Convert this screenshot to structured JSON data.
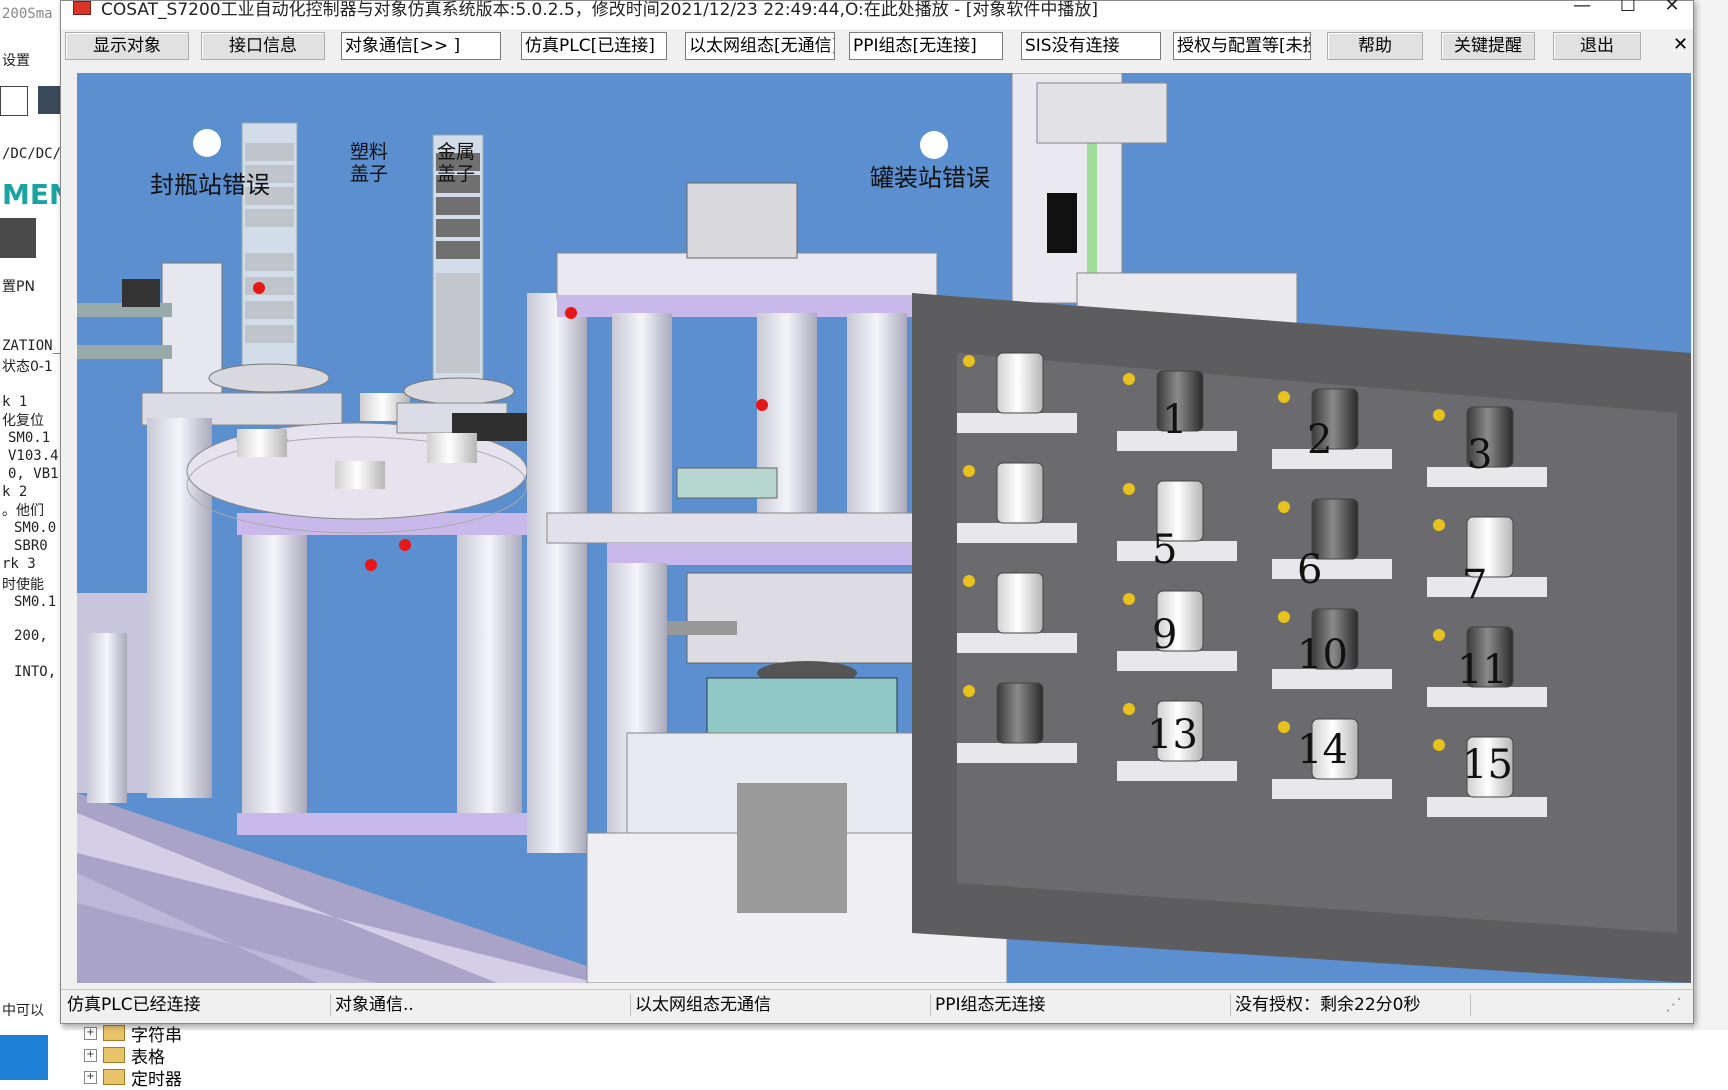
{
  "window": {
    "title": "COSAT_S7200工业自动化控制器与对象仿真系统版本:5.0.2.5，修改时间2021/12/23 22:49:44,O:在此处播放 - [对象软件中播放]",
    "minimize": "—",
    "maximize": "☐",
    "close": "✕"
  },
  "toolbar": {
    "show_objects": "显示对象",
    "interface_info": "接口信息",
    "object_comm": "对象通信[>>  ]",
    "sim_plc": "仿真PLC[已连接]",
    "ethernet": "以太网组态[无通信]",
    "ppi": "PPI组态[无连接]",
    "sis": "SIS没有连接",
    "license": "授权与配置等[未授权]",
    "help": "帮助",
    "key_reminder": "关键提醒",
    "exit": "退出",
    "close_x": "✕"
  },
  "scene": {
    "capping_error": "封瓶站错误",
    "filling_error": "罐装站错误",
    "plastic_cap": [
      "塑料",
      "盖子"
    ],
    "metal_cap": [
      "金属",
      "盖子"
    ],
    "slot_numbers": [
      "1",
      "2",
      "3",
      "5",
      "6",
      "7",
      "9",
      "10",
      "11",
      "13",
      "14",
      "15"
    ]
  },
  "statusbar": {
    "plc": "仿真PLC已经连接",
    "comm": "对象通信..",
    "ethernet": "以太网组态无通信",
    "ppi": "PPI组态无连接",
    "license": "没有授权：剩余22分0秒"
  },
  "background": {
    "left_lines": [
      "200Sma",
      "设置",
      "",
      "/DC/DC/",
      "MEN",
      "",
      "置PN",
      "ZATION_",
      "状态0-1",
      "k 1",
      "化复位",
      "SM0.1",
      "V103.4",
      "0, VB1",
      "k 2",
      "。他们",
      "SM0.0",
      "SBR0",
      "rk 3",
      "时使能",
      "SM0.1",
      "200,",
      "INTO,"
    ],
    "tree_items": [
      "字符串",
      "表格",
      "定时器"
    ],
    "bottom_left": "中可以"
  }
}
